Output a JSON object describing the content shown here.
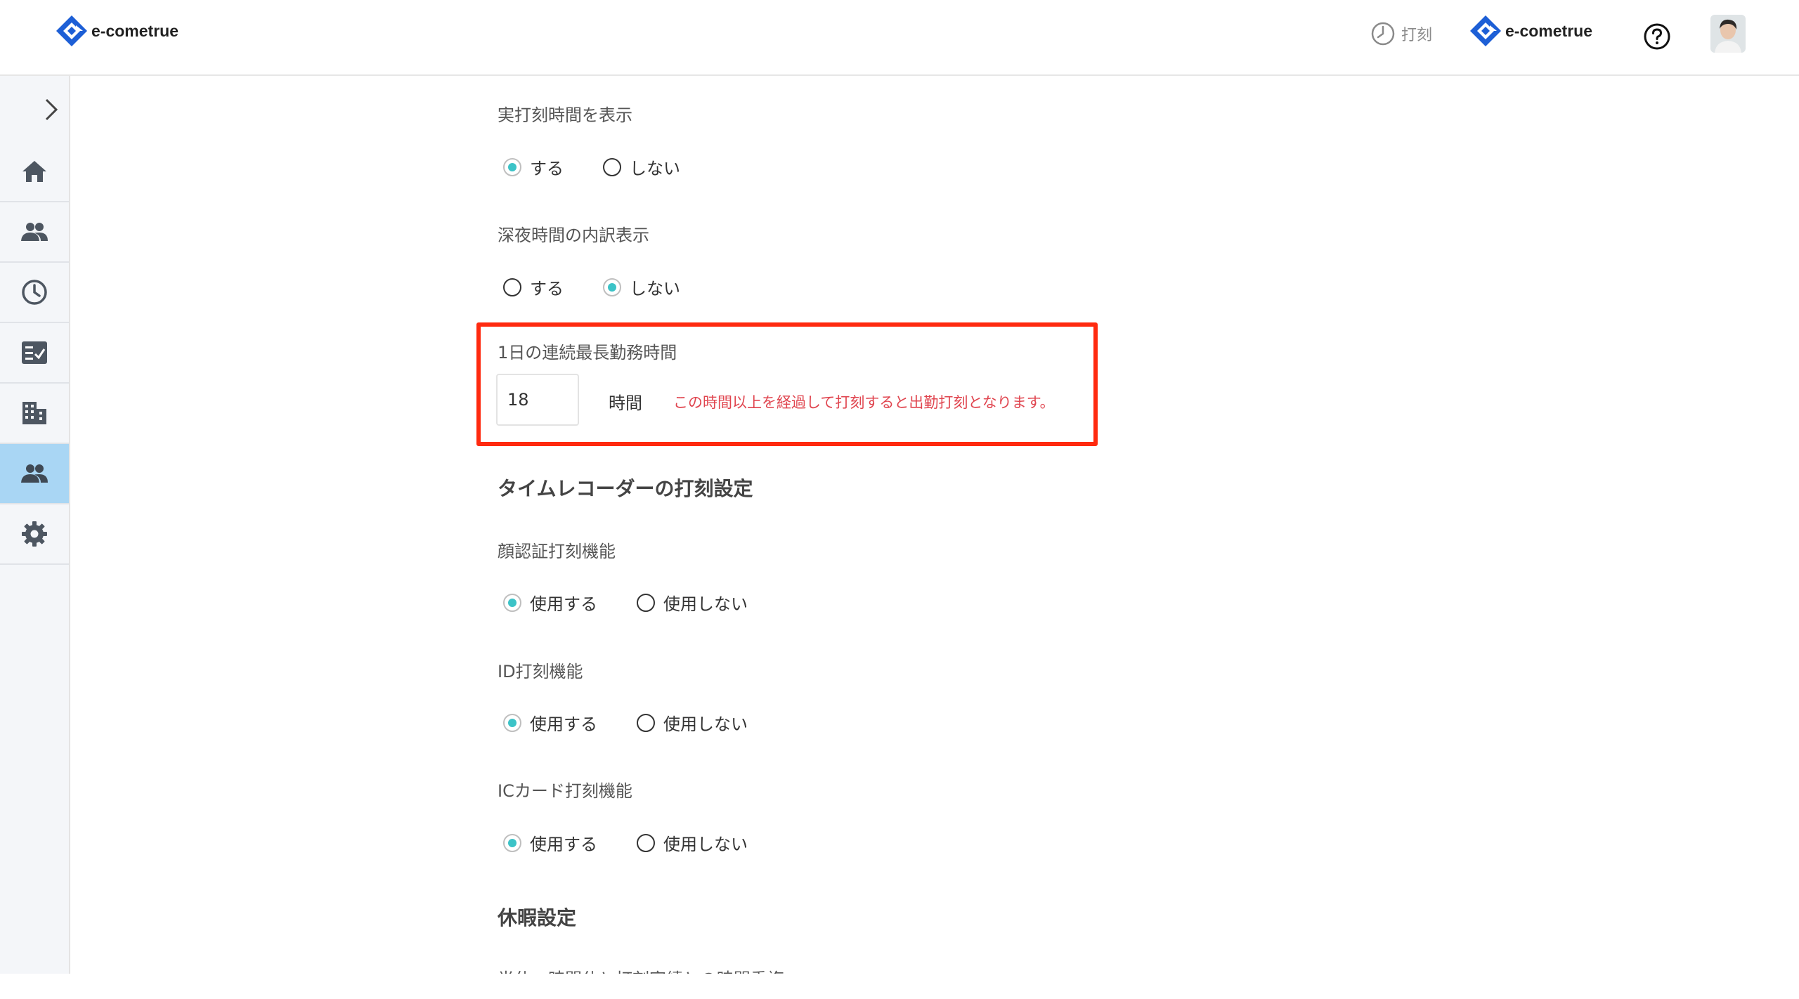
{
  "header": {
    "logo_text": "e-cometrue",
    "stamp_label": "打刻",
    "company_logo_text": "e-cometrue"
  },
  "sidebar": {
    "items": [
      {
        "icon": "home-icon"
      },
      {
        "icon": "people-icon"
      },
      {
        "icon": "clock-icon"
      },
      {
        "icon": "checklist-icon"
      },
      {
        "icon": "building-icon"
      },
      {
        "icon": "people-icon",
        "active": true
      },
      {
        "icon": "gear-icon"
      }
    ]
  },
  "settings": {
    "actual_time": {
      "label": "実打刻時間を表示",
      "options": [
        "する",
        "しない"
      ],
      "selected": "する"
    },
    "night_breakdown": {
      "label": "深夜時間の内訳表示",
      "options": [
        "する",
        "しない"
      ],
      "selected": "しない"
    },
    "max_continuous": {
      "label": "1日の連続最長勤務時間",
      "value": "18",
      "unit": "時間",
      "note": "この時間以上を経過して打刻すると出勤打刻となります。"
    },
    "time_recorder_title": "タイムレコーダーの打刻設定",
    "face_auth": {
      "label": "顔認証打刻機能",
      "options": [
        "使用する",
        "使用しない"
      ],
      "selected": "使用する"
    },
    "id_stamp": {
      "label": "ID打刻機能",
      "options": [
        "使用する",
        "使用しない"
      ],
      "selected": "使用する"
    },
    "ic_card": {
      "label": "ICカード打刻機能",
      "options": [
        "使用する",
        "使用しない"
      ],
      "selected": "使用する"
    },
    "leave_title": "休暇設定",
    "cut_off_label": "半休・時間休と打刻実績との時間重複"
  },
  "colors": {
    "accent": "#3cc3c7",
    "highlight": "#ff2a0f",
    "note": "#e0454f",
    "sidebar_active": "#a9d6f4"
  }
}
